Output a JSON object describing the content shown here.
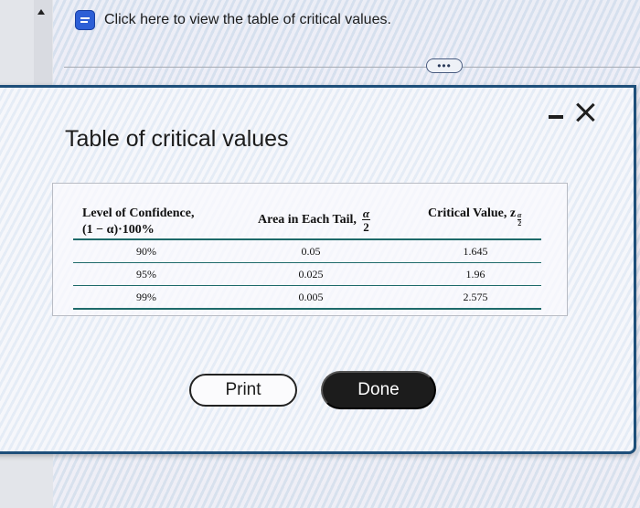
{
  "background": {
    "link_text": "Click here to view the table of critical values.",
    "link_icon": "document-icon",
    "more_pill": "•••"
  },
  "dialog": {
    "title": "Table of critical values",
    "minimize_icon": "minimize-icon",
    "close_icon": "close-icon",
    "table": {
      "headers": {
        "confidence_line1": "Level of Confidence,",
        "confidence_line2": "(1 − α)·100%",
        "area": "Area in Each Tail,",
        "area_frac_num": "α",
        "area_frac_den": "2",
        "critical": "Critical Value, z",
        "critical_sub_num": "α",
        "critical_sub_den": "2"
      },
      "rows": [
        {
          "confidence": "90%",
          "area": "0.05",
          "critical": "1.645"
        },
        {
          "confidence": "95%",
          "area": "0.025",
          "critical": "1.96"
        },
        {
          "confidence": "99%",
          "area": "0.005",
          "critical": "2.575"
        }
      ]
    },
    "buttons": {
      "print": "Print",
      "done": "Done"
    }
  },
  "colors": {
    "dialog_border": "#1e4f7a",
    "table_rule": "#1e6a6a",
    "done_button": "#1c1c1c",
    "icon_blue": "#2d5fd6"
  }
}
